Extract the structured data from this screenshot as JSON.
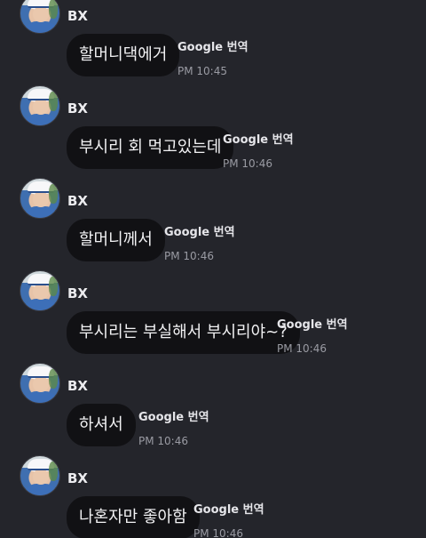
{
  "messages": [
    {
      "sender": "BX",
      "text": "할머니댁에거",
      "translate_label": "Google 번역",
      "time": "PM 10:45"
    },
    {
      "sender": "BX",
      "text": "부시리 회 먹고있는데",
      "translate_label": "Google 번역",
      "time": "PM 10:46"
    },
    {
      "sender": "BX",
      "text": "할머니께서",
      "translate_label": "Google 번역",
      "time": "PM 10:46"
    },
    {
      "sender": "BX",
      "text": "부시리는 부실해서 부시리야~?",
      "translate_label": "Google 번역",
      "time": "PM 10:46"
    },
    {
      "sender": "BX",
      "text": "하셔서",
      "translate_label": "Google 번역",
      "time": "PM 10:46"
    },
    {
      "sender": "BX",
      "text": "나혼자만 좋아함",
      "translate_label": "Google 번역",
      "time": "PM 10:46"
    }
  ]
}
